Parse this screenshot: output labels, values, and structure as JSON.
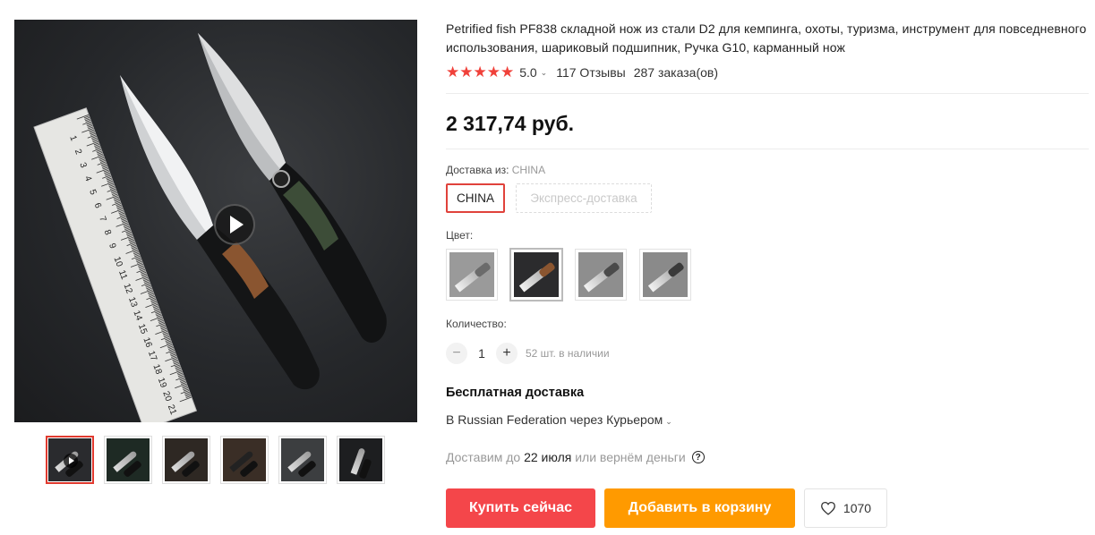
{
  "product": {
    "title": "Petrified fish PF838 складной нож из стали D2 для кемпинга, охоты, туризма, инструмент для повседневного использования, шариковый подшипник, Ручка G10, карманный нож",
    "rating": {
      "stars": "★★★★★",
      "value": "5.0",
      "reviews": "117 Отзывы",
      "orders": "287 заказа(ов)"
    },
    "price": "2 317,74 руб."
  },
  "gallery": {
    "thumbnail_count": 6,
    "active_thumbnail": 1,
    "ruler_numbers": [
      "1",
      "2",
      "3",
      "4",
      "5",
      "6",
      "7",
      "8",
      "9",
      "10",
      "11",
      "12",
      "13",
      "14",
      "15",
      "16",
      "17",
      "18",
      "19",
      "20",
      "21"
    ]
  },
  "shipping_from": {
    "label": "Доставка из:",
    "value": "CHINA",
    "options": [
      {
        "label": "CHINA",
        "selected": true
      },
      {
        "label": "Экспресс-доставка",
        "selected": false
      }
    ]
  },
  "color": {
    "label": "Цвет:",
    "active_index": 1
  },
  "quantity": {
    "label": "Количество:",
    "minus": "−",
    "value": "1",
    "plus": "+",
    "stock": "52 шт. в наличии"
  },
  "delivery": {
    "free_shipping": "Бесплатная доставка",
    "destination": "В Russian Federation через Курьером",
    "text_before": "Доставим до",
    "date": "22 июля",
    "text_after": "или вернём деньги",
    "help": "?"
  },
  "actions": {
    "buy_now": "Купить сейчас",
    "add_to_cart": "Добавить в корзину",
    "wishlist_count": "1070"
  },
  "colors": {
    "buy": "#f4464a",
    "cart": "#ff9a00",
    "star": "#f0413a",
    "selected_border": "#e0423b"
  }
}
